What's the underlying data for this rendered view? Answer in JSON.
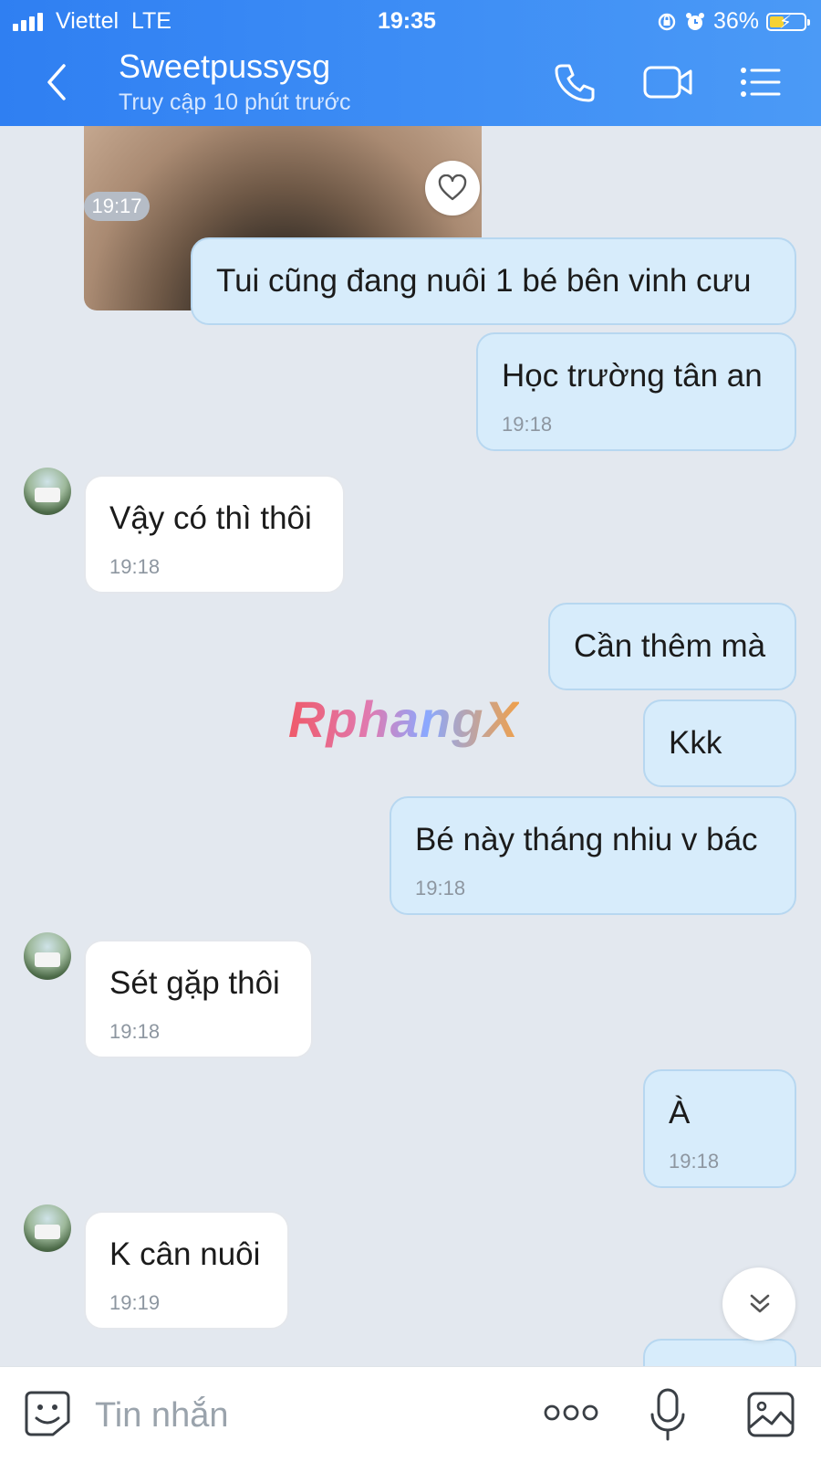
{
  "status_bar": {
    "carrier": "Viettel",
    "network": "LTE",
    "time": "19:35",
    "battery_percent": "36%"
  },
  "header": {
    "contact_name": "Sweetpussysg",
    "contact_status": "Truy cập 10 phút trước"
  },
  "photo_message": {
    "time": "19:17"
  },
  "messages": [
    {
      "direction": "out",
      "text": "Tui cũng đang nuôi 1 bé bên vinh cưu",
      "time": ""
    },
    {
      "direction": "out",
      "text": "Học trường tân an",
      "time": "19:18"
    },
    {
      "direction": "in",
      "text": "Vậy có thì thôi",
      "time": "19:18"
    },
    {
      "direction": "out",
      "text": "Cần thêm mà",
      "time": ""
    },
    {
      "direction": "out",
      "text": "Kkk",
      "time": ""
    },
    {
      "direction": "out",
      "text": "Bé này tháng nhiu v bác",
      "time": "19:18"
    },
    {
      "direction": "in",
      "text": "Sét gặp thôi",
      "time": "19:18"
    },
    {
      "direction": "out",
      "text": "À",
      "time": "19:18"
    },
    {
      "direction": "in",
      "text": "K cân nuôi",
      "time": "19:19"
    }
  ],
  "watermark": "RphangX",
  "composer": {
    "placeholder": "Tin nhắn"
  },
  "colors": {
    "header_blue": "#3d8df5",
    "outgoing_bubble": "#d7ecfb",
    "incoming_bubble": "#ffffff",
    "chat_background": "#e3e8ef"
  },
  "icons": [
    "back-icon",
    "phone-icon",
    "video-call-icon",
    "menu-icon",
    "heart-icon",
    "chevron-double-down-icon",
    "sticker-icon",
    "more-icon",
    "microphone-icon",
    "image-icon"
  ]
}
